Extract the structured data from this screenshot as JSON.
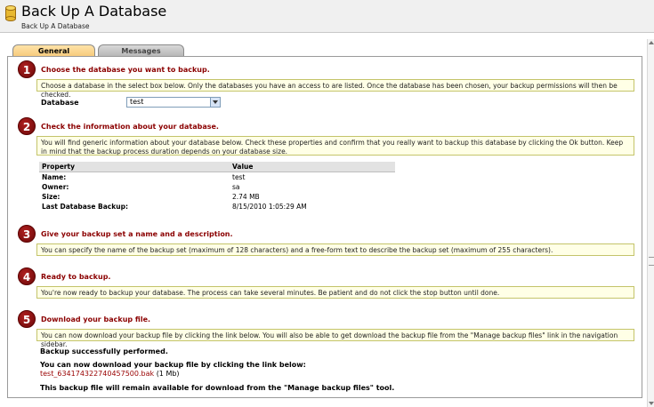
{
  "header": {
    "title": "Back Up A Database",
    "breadcrumb": "Back Up A Database"
  },
  "tabs": [
    {
      "label": "General",
      "active": true
    },
    {
      "label": "Messages",
      "active": false
    }
  ],
  "steps": [
    {
      "number": "1",
      "title": "Choose the database you want to backup.",
      "info": "Choose a database in the select box below. Only the databases you have an access to are listed. Once the database has been chosen, your backup permissions will then be checked."
    },
    {
      "number": "2",
      "title": "Check the information about your database.",
      "info": "You will find generic information about your database below. Check these properties and confirm that you really want to backup this database by clicking the Ok button. Keep in mind that the backup process duration depends on your database size."
    },
    {
      "number": "3",
      "title": "Give your backup set a name and a description.",
      "info": "You can specify the name of the backup set (maximum of 128 characters) and a free-form text to describe the backup set (maximum of 255 characters)."
    },
    {
      "number": "4",
      "title": "Ready to backup.",
      "info": "You're now ready to backup your database. The process can take several minutes. Be patient and do not click the stop button until done."
    },
    {
      "number": "5",
      "title": "Download your backup file.",
      "info": "You can now download your backup file by clicking the link below. You will also be able to get download the backup file from the \"Manage backup files\" link in the navigation sidebar."
    }
  ],
  "database": {
    "label": "Database",
    "selected": "test"
  },
  "properties": {
    "headers": [
      "Property",
      "Value"
    ],
    "rows": [
      [
        "Name:",
        "test"
      ],
      [
        "Owner:",
        "sa"
      ],
      [
        "Size:",
        "2.74 MB"
      ],
      [
        "Last Database Backup:",
        "8/15/2010 1:05:29 AM"
      ]
    ]
  },
  "result": {
    "success": "Backup successfully performed.",
    "download_prompt": "You can now download your backup file by clicking the link below:",
    "file_link": "test_634174322740457500.bak",
    "file_size": "(1 Mb)",
    "availability": "This backup file will remain available for download from the \"Manage backup files\" tool."
  },
  "colors": {
    "step_title": "#8b0000",
    "info_background": "#ffffe6",
    "link": "#990000"
  }
}
